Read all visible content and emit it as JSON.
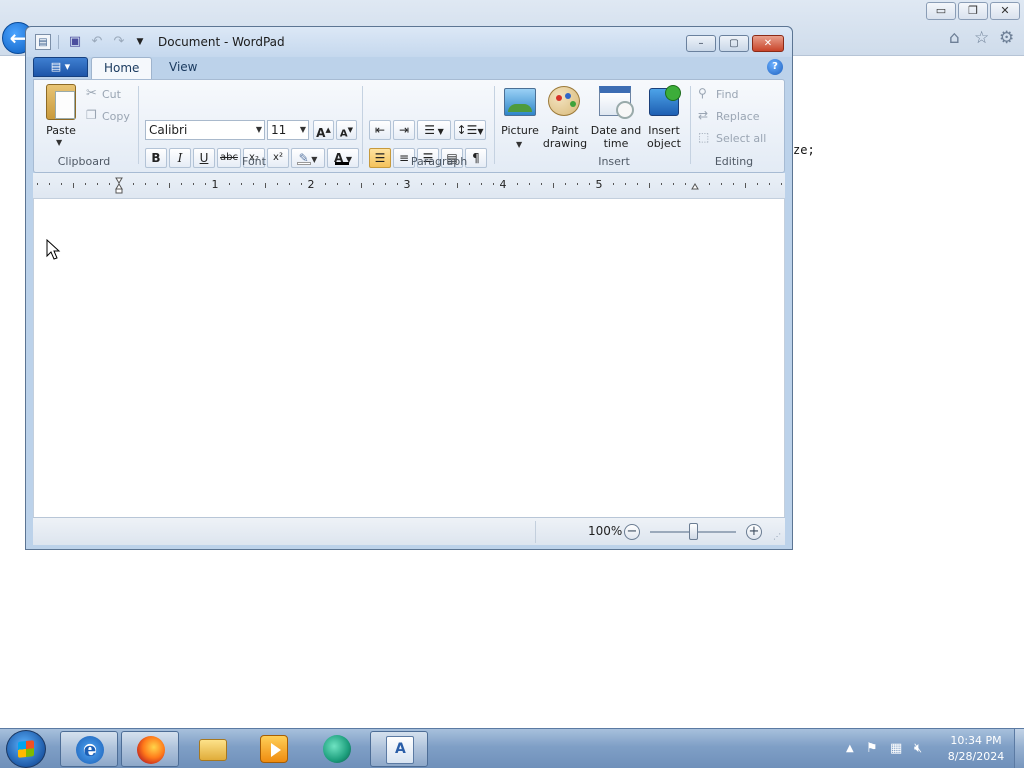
{
  "background_browser": {
    "code_fragment": "ze;",
    "controls": {
      "minimize": "▭",
      "restore": "❐",
      "close": "✕"
    },
    "icons": [
      "back-arrow-icon",
      "home-icon",
      "star-icon",
      "gear-icon"
    ]
  },
  "window": {
    "title": "Document - WordPad",
    "controls": {
      "minimize": "–",
      "maximize": "▢",
      "close": "✕"
    }
  },
  "ribbon": {
    "tabs": [
      {
        "label": "Home",
        "active": true
      },
      {
        "label": "View",
        "active": false
      }
    ],
    "groups": {
      "clipboard": {
        "label": "Clipboard",
        "paste": "Paste",
        "cut": "Cut",
        "copy": "Copy"
      },
      "font": {
        "label": "Font",
        "font_name": "Calibri",
        "font_size": "11",
        "bold": "B",
        "italic": "I",
        "underline": "U",
        "strikethrough": "abc",
        "subscript": "x₂",
        "superscript": "x²"
      },
      "paragraph": {
        "label": "Paragraph"
      },
      "insert": {
        "label": "Insert",
        "picture": "Picture",
        "paint": "Paint drawing",
        "datetime": "Date and time",
        "object": "Insert object"
      },
      "editing": {
        "label": "Editing",
        "find": "Find",
        "replace": "Replace",
        "select_all": "Select all"
      }
    }
  },
  "ruler": {
    "numbers": [
      "1",
      "2",
      "3",
      "4",
      "5"
    ]
  },
  "statusbar": {
    "zoom": "100%",
    "zoom_out": "−",
    "zoom_in": "+",
    "zoom_level_fraction": 0.5
  },
  "taskbar": {
    "apps": [
      "internet-explorer",
      "firefox",
      "file-explorer",
      "media-player",
      "green-app",
      "wordpad"
    ],
    "clock": {
      "time": "10:34 PM",
      "date": "8/28/2024"
    }
  },
  "colors": {
    "accent": "#1d55a8",
    "ribbon": "#e3ebf5",
    "taskbar": "#7f9fc6",
    "active_align": "#f4c25b"
  }
}
